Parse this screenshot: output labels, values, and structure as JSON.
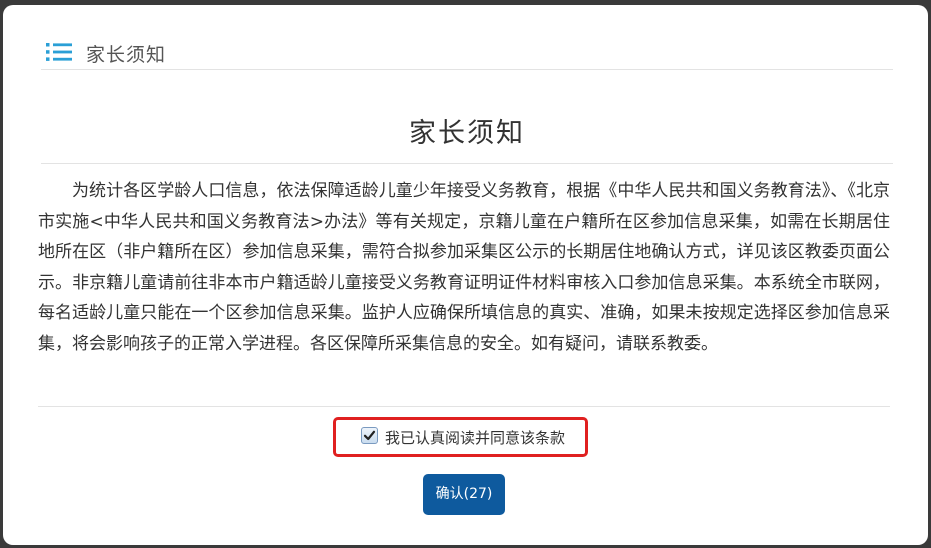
{
  "header": {
    "icon": "list-icon",
    "title": "家长须知"
  },
  "notice": {
    "title": "家长须知",
    "body": "为统计各区学龄人口信息，依法保障适龄儿童少年接受义务教育，根据《中华人民共和国义务教育法》、《北京市实施<中华人民共和国义务教育法>办法》等有关规定，京籍儿童在户籍所在区参加信息采集，如需在长期居住地所在区（非户籍所在区）参加信息采集，需符合拟参加采集区公示的长期居住地确认方式，详见该区教委页面公示。非京籍儿童请前往非本市户籍适龄儿童接受义务教育证明证件材料审核入口参加信息采集。本系统全市联网，每名适龄儿童只能在一个区参加信息采集。监护人应确保所填信息的真实、准确，如果未按规定选择区参加信息采集，将会影响孩子的正常入学进程。各区保障所采集信息的安全。如有疑问，请联系教委。"
  },
  "agreement": {
    "checked": true,
    "label": "我已认真阅读并同意该条款"
  },
  "confirm": {
    "label": "确认(27)"
  },
  "colors": {
    "accent": "#2a9fd6",
    "button": "#0e5a9e",
    "highlight": "#e02020"
  }
}
